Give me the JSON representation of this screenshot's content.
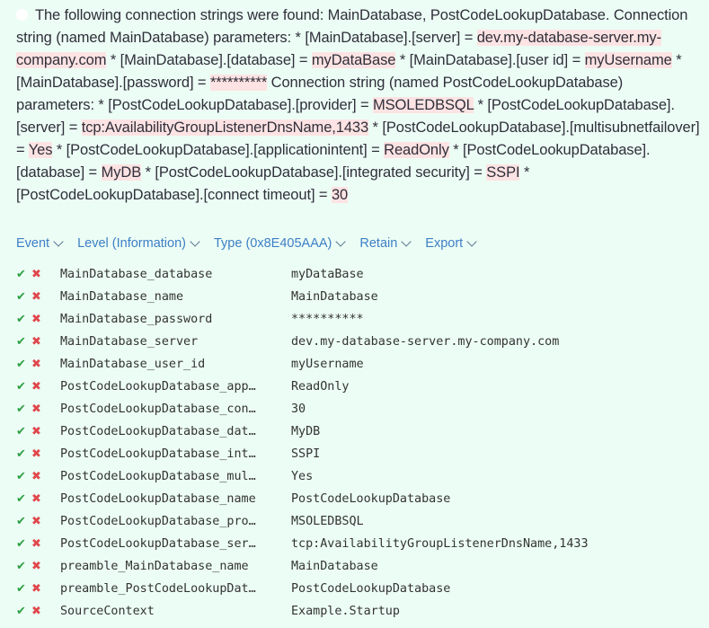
{
  "message": {
    "segments": [
      {
        "text": "The following connection strings were found: MainDatabase, PostCodeLookupDatabase. Connection string (named MainDatabase) parameters: * [MainDatabase].[server] = ",
        "hl": false
      },
      {
        "text": "dev.my-database-server.my-company.com",
        "hl": true
      },
      {
        "text": " * [MainDatabase].[database] = ",
        "hl": false
      },
      {
        "text": "myDataBase",
        "hl": true
      },
      {
        "text": " * [MainDatabase].[user id] = ",
        "hl": false
      },
      {
        "text": "myUsername",
        "hl": true
      },
      {
        "text": " * [MainDatabase].[password] = ",
        "hl": false
      },
      {
        "text": "**********",
        "hl": true
      },
      {
        "text": " Connection string (named PostCodeLookupDatabase) parameters: * [PostCodeLookupDatabase].[provider] = ",
        "hl": false
      },
      {
        "text": "MSOLEDBSQL",
        "hl": true
      },
      {
        "text": " * [PostCodeLookupDatabase].[server] = ",
        "hl": false
      },
      {
        "text": "tcp:AvailabilityGroupListenerDnsName,1433",
        "hl": true
      },
      {
        "text": " * [PostCodeLookupDatabase].[multisubnetfailover] = ",
        "hl": false
      },
      {
        "text": "Yes",
        "hl": true
      },
      {
        "text": " * [PostCodeLookupDatabase].[applicationintent] = ",
        "hl": false
      },
      {
        "text": "ReadOnly",
        "hl": true
      },
      {
        "text": " * [PostCodeLookupDatabase].[database] = ",
        "hl": false
      },
      {
        "text": "MyDB",
        "hl": true
      },
      {
        "text": " * [PostCodeLookupDatabase].[integrated security] = ",
        "hl": false
      },
      {
        "text": "SSPI",
        "hl": true
      },
      {
        "text": " * [PostCodeLookupDatabase].[connect timeout] = ",
        "hl": false
      },
      {
        "text": "30",
        "hl": true
      }
    ]
  },
  "toolbar": {
    "event_label": "Event",
    "level_label": "Level (Information)",
    "type_label": "Type (0x8E405AAA)",
    "retain_label": "Retain",
    "export_label": "Export"
  },
  "icons": {
    "include": "✔",
    "exclude": "✖"
  },
  "colors": {
    "background": "#ecfdf5",
    "link": "#3d7fc6",
    "highlight": "#fde3e3",
    "check": "#2ea043",
    "cross": "#e0474c"
  },
  "properties": [
    {
      "name": "MainDatabase_database",
      "value": "myDataBase"
    },
    {
      "name": "MainDatabase_name",
      "value": "MainDatabase"
    },
    {
      "name": "MainDatabase_password",
      "value": "**********"
    },
    {
      "name": "MainDatabase_server",
      "value": "dev.my-database-server.my-company.com"
    },
    {
      "name": "MainDatabase_user_id",
      "value": "myUsername"
    },
    {
      "name": "PostCodeLookupDatabase_app…",
      "value": "ReadOnly"
    },
    {
      "name": "PostCodeLookupDatabase_con…",
      "value": "30"
    },
    {
      "name": "PostCodeLookupDatabase_dat…",
      "value": "MyDB"
    },
    {
      "name": "PostCodeLookupDatabase_int…",
      "value": "SSPI"
    },
    {
      "name": "PostCodeLookupDatabase_mul…",
      "value": "Yes"
    },
    {
      "name": "PostCodeLookupDatabase_name",
      "value": "PostCodeLookupDatabase"
    },
    {
      "name": "PostCodeLookupDatabase_pro…",
      "value": "MSOLEDBSQL"
    },
    {
      "name": "PostCodeLookupDatabase_ser…",
      "value": "tcp:AvailabilityGroupListenerDnsName,1433"
    },
    {
      "name": "preamble_MainDatabase_name",
      "value": "MainDatabase"
    },
    {
      "name": "preamble_PostCodeLookupDat…",
      "value": "PostCodeLookupDatabase"
    },
    {
      "name": "SourceContext",
      "value": "Example.Startup"
    }
  ]
}
